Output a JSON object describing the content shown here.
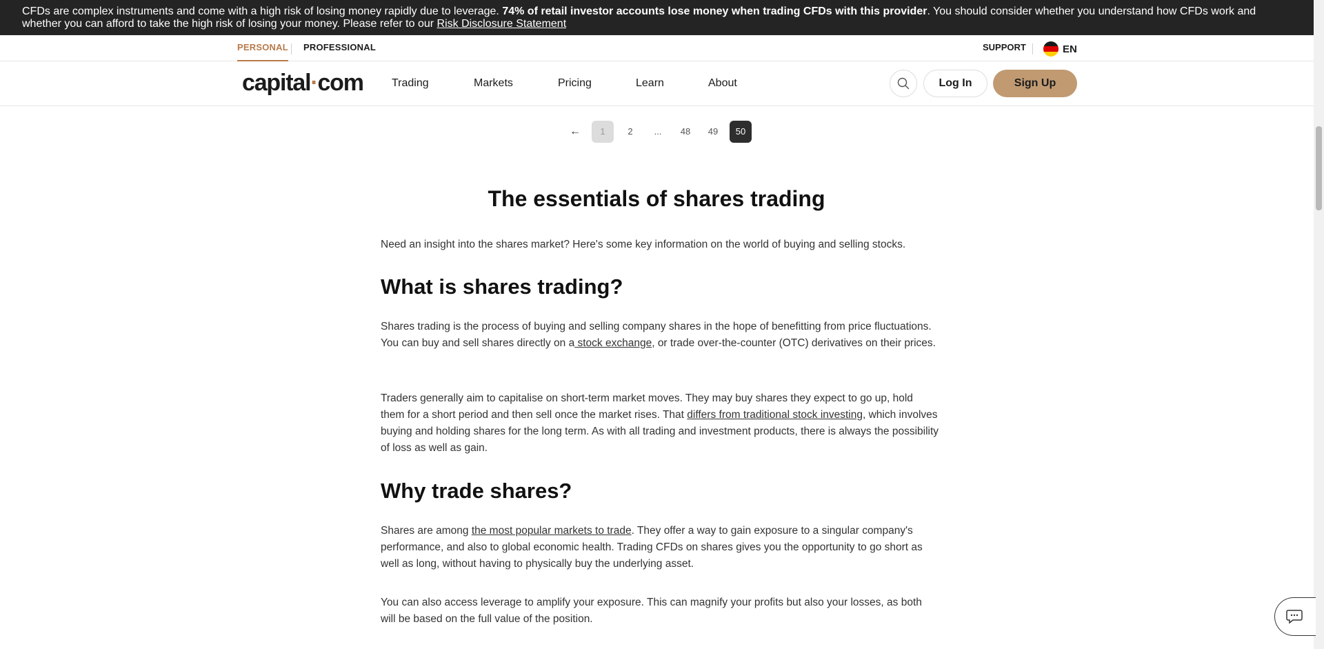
{
  "risk_banner": {
    "text_start": "CFDs are complex instruments and come with a high risk of losing money rapidly due to leverage. ",
    "text_bold": "74% of retail investor accounts lose money when trading CFDs with this provider",
    "text_end": ". You should consider whether you understand how CFDs work and whether you can afford to take the high risk of losing your money. Please refer to our ",
    "link": "Risk Disclosure Statement"
  },
  "top_strip": {
    "personal": "PERSONAL",
    "professional": "PROFESSIONAL",
    "support": "SUPPORT",
    "language": "EN"
  },
  "nav": {
    "logo_left": "capital",
    "logo_dot": "·",
    "logo_right": "com",
    "items": [
      "Trading",
      "Markets",
      "Pricing",
      "Learn",
      "About"
    ],
    "login": "Log In",
    "signup": "Sign Up"
  },
  "pagination": {
    "prev": "←",
    "pages": [
      "1",
      "2",
      "...",
      "48",
      "49",
      "50"
    ],
    "current": "1",
    "selected": "50"
  },
  "article": {
    "title": "The essentials of shares trading",
    "intro": "Need an insight into the shares market? Here's some key information on the world of buying and selling stocks.",
    "h_what": "What is shares trading?",
    "p1_a": "Shares trading is the process of buying and selling company shares in the hope of benefitting from price fluctuations. You can buy and sell shares directly on a",
    "p1_link": " stock exchange",
    "p1_b": ", or trade over-the-counter (OTC) derivatives on their prices.",
    "p2_a": "Traders generally aim to capitalise on short-term market moves. They may buy shares they expect to go up, hold them for a short period and then sell once the market rises. That ",
    "p2_link": "differs from traditional stock investing",
    "p2_b": ", which involves buying and holding shares for the long term. As with all trading and investment products, there is always the possibility of loss as well as gain.",
    "h_why": "Why trade shares?",
    "p3_a": "Shares are among ",
    "p3_link": "the most popular markets to trade",
    "p3_b": ". They offer a way to gain exposure to a singular company's performance, and also to global economic health. Trading CFDs on shares gives you the opportunity to go short as well as long, without having to physically buy the underlying asset.",
    "p4": "You can also access leverage to amplify your exposure. This can magnify your profits but also your losses, as both will be based on the full value of the position."
  },
  "colors": {
    "accent": "#b87a4b",
    "signup_bg": "#c19a72",
    "banner_bg": "#242424"
  },
  "icons": [
    "search-icon",
    "germany-flag-icon",
    "chat-icon",
    "arrow-left-icon"
  ]
}
